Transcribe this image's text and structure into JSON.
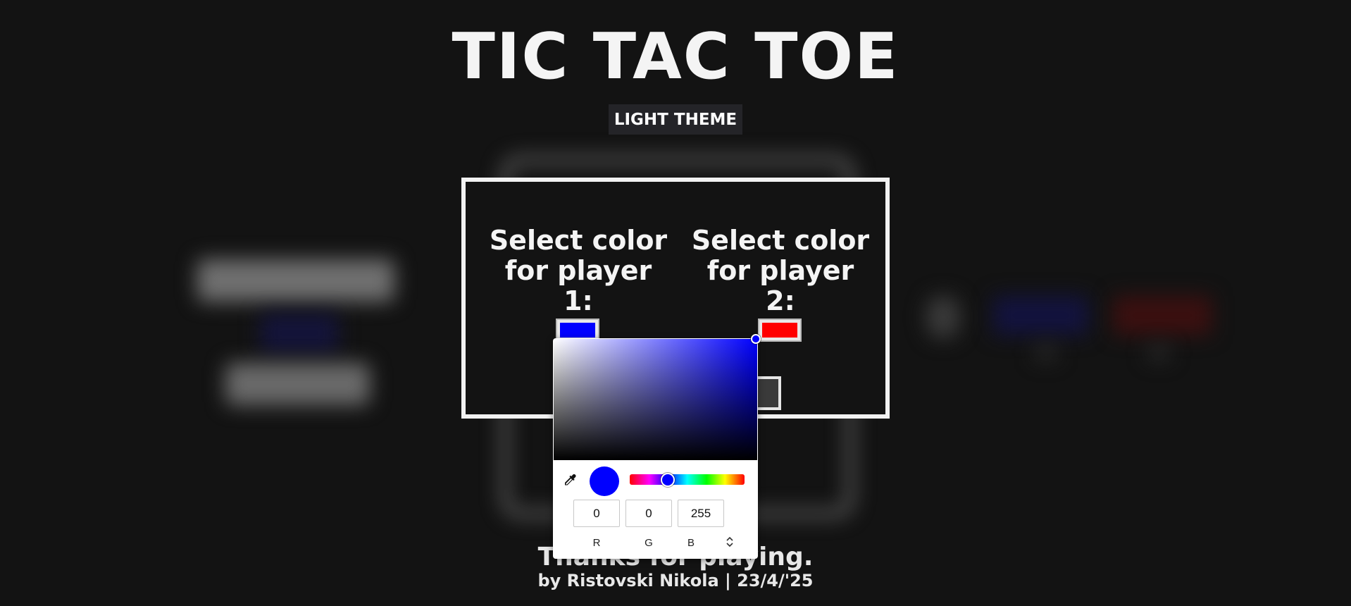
{
  "header": {
    "title": "TIC TAC TOE",
    "theme_button_label": "LIGHT THEME"
  },
  "color_modal": {
    "player1_heading": "Select color\nfor player 1:",
    "player2_heading": "Select color\nfor player 2:",
    "player1_color": "#0000ff",
    "player2_color": "#ff0000"
  },
  "color_picker": {
    "current_color": "#0000ff",
    "hue_position": 0.33,
    "saturation": 1.0,
    "brightness": 1.0,
    "channels": [
      {
        "label": "R",
        "value": "0"
      },
      {
        "label": "G",
        "value": "0"
      },
      {
        "label": "B",
        "value": "255"
      }
    ],
    "eyedropper_icon": "eyedropper-icon",
    "format_toggle_icon": "up-down-chevron-icon"
  },
  "footer": {
    "thanks": "Thanks for playing.",
    "credit": "by Ristovski Nikola | 23/4/'25"
  }
}
